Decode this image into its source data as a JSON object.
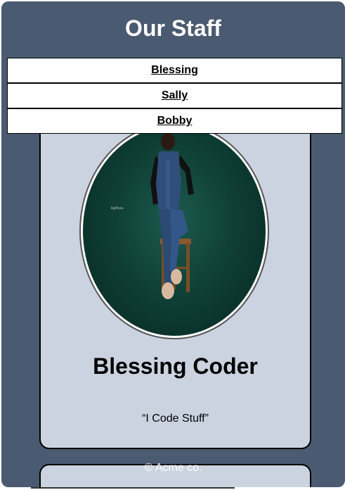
{
  "header": {
    "title": "Our Staff"
  },
  "nav": {
    "items": [
      {
        "label": "Blessing"
      },
      {
        "label": "Sally"
      },
      {
        "label": "Bobby"
      }
    ]
  },
  "staff_card": {
    "name": "Blessing Coder",
    "quote": "“I Code Stuff”",
    "photo_watermark": "BgPhoto"
  },
  "footer": {
    "text": "© Acme co."
  },
  "colors": {
    "frame": "#4a5a70",
    "card": "#cbd3e0",
    "photo_background": "#0f4036"
  }
}
